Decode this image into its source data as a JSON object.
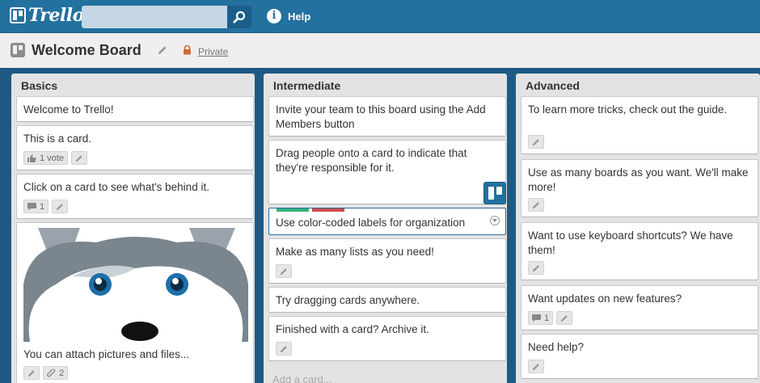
{
  "header": {
    "logo": "Trello",
    "search_placeholder": "",
    "help": "Help"
  },
  "board": {
    "title": "Welcome Board",
    "privacy": "Private"
  },
  "lists": [
    {
      "title": "Basics",
      "cards": [
        {
          "text": "Welcome to Trello!"
        },
        {
          "text": "This is a card.",
          "votes": "1 vote"
        },
        {
          "text": "Click on a card to see what's behind it.",
          "comments": "1"
        },
        {
          "text": "You can attach pictures and files...",
          "attachments": "2"
        }
      ]
    },
    {
      "title": "Intermediate",
      "cards": [
        {
          "text": "Invite your team to this board using the Add Members button"
        },
        {
          "text": "Drag people onto a card to indicate that they're responsible for it."
        },
        {
          "text": "Use color-coded labels for organization"
        },
        {
          "text": "Make as many lists as you need!"
        },
        {
          "text": "Try dragging cards anywhere."
        },
        {
          "text": "Finished with a card? Archive it."
        }
      ],
      "add_card": "Add a card..."
    },
    {
      "title": "Advanced",
      "cards": [
        {
          "text": "To learn more tricks, check out the guide."
        },
        {
          "text": "Use as many boards as you want. We'll make more!"
        },
        {
          "text": "Want to use keyboard shortcuts? We have them!"
        },
        {
          "text": "Want updates on new features?",
          "comments": "1"
        },
        {
          "text": "Need help?"
        }
      ]
    }
  ],
  "colors": {
    "header": "#23719f",
    "board": "#1f5a84",
    "label_green": "#34b27d",
    "label_red": "#cb4d4d"
  }
}
